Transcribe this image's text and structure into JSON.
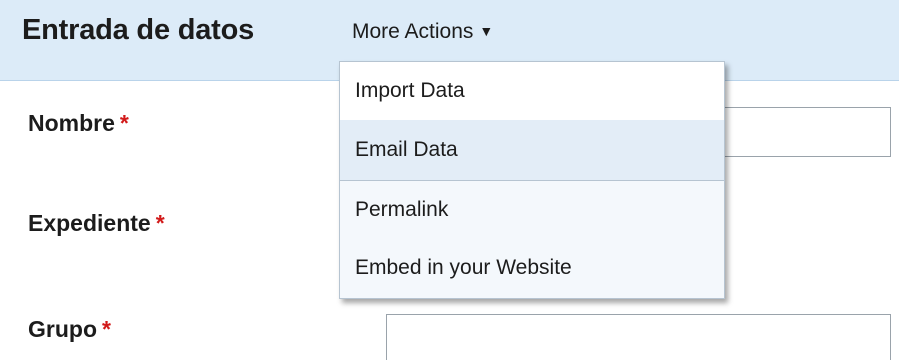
{
  "header": {
    "title": "Entrada de datos",
    "more_actions_label": "More Actions",
    "caret_icon": "▼"
  },
  "form": {
    "required_marker": "*",
    "fields": [
      {
        "label": "Nombre",
        "value": ""
      },
      {
        "label": "Expediente",
        "value": ""
      },
      {
        "label": "Grupo",
        "value": ""
      }
    ]
  },
  "menu": {
    "items": [
      {
        "label": "Import Data"
      },
      {
        "label": "Email Data"
      },
      {
        "label": "Permalink"
      },
      {
        "label": "Embed in your Website"
      }
    ]
  },
  "colors": {
    "header_bg": "#dcebf8",
    "required": "#d21a1a",
    "menu_hover": "#e3edf7"
  }
}
